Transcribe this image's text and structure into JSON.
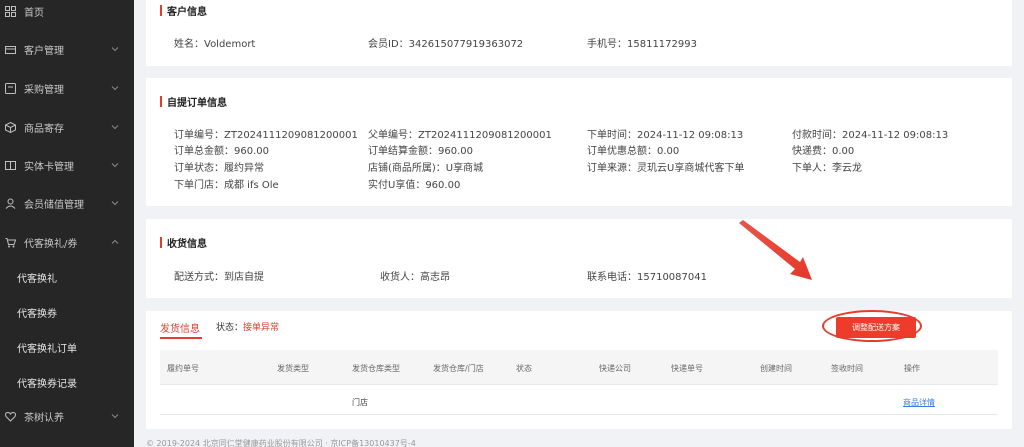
{
  "sidebar": {
    "items": [
      {
        "label": "首页",
        "icon": "grid-icon"
      },
      {
        "label": "客户管理",
        "icon": "folder-icon"
      },
      {
        "label": "采购管理",
        "icon": "cart-icon"
      },
      {
        "label": "商品寄存",
        "icon": "box-icon"
      },
      {
        "label": "实体卡管理",
        "icon": "book-icon"
      },
      {
        "label": "会员储值管理",
        "icon": "user-icon"
      },
      {
        "label": "代客换礼/券",
        "icon": "cart-icon"
      },
      {
        "label": "茶树认养",
        "icon": "heart-icon"
      }
    ],
    "sub_items": [
      {
        "label": "代客换礼"
      },
      {
        "label": "代客换券"
      },
      {
        "label": "代客换礼订单"
      },
      {
        "label": "代客换券记录"
      }
    ]
  },
  "customer": {
    "title": "客户信息",
    "name": "姓名：Voldemort",
    "member_id": "会员ID：342615077919363072",
    "phone": "手机号：15811172993"
  },
  "order": {
    "title": "自提订单信息",
    "order_no": "订单编号：ZT2024111209081200001",
    "parent_no": "父单编号：ZT2024111209081200001",
    "order_time": "下单时间：2024-11-12 09:08:13",
    "pay_time": "付款时间：2024-11-12 09:08:13",
    "total": "订单总金额：960.00",
    "settle": "订单结算金额：960.00",
    "discount": "订单优惠总额：0.00",
    "express_fee": "快递费：0.00",
    "status": "订单状态：履约异常",
    "shop": "店铺(商品所属)：U享商城",
    "source": "订单来源：灵玑云U享商城代客下单",
    "orderer": "下单人：李云龙",
    "store": "下单门店：成都 ifs Ole",
    "paid": "实付U享值：960.00"
  },
  "receive": {
    "title": "收货信息",
    "method": "配送方式：到店自提",
    "receiver": "收货人：高志昂",
    "phone": "联系电话：15710087041"
  },
  "shipping": {
    "tab": "发货信息",
    "status_label": "状态：",
    "status_value": "接单异常",
    "adjust_button": "调整配送方案",
    "columns": [
      "履约单号",
      "发货类型",
      "发货仓库类型",
      "发货仓库/门店",
      "状态",
      "快递公司",
      "快递单号",
      "创建时间",
      "签收时间",
      "操作"
    ],
    "row": {
      "warehouse_type": "门店",
      "action": "商品详情"
    }
  },
  "footer": "© 2019-2024 北京同仁堂健康药业股份有限公司 · 京ICP备13010437号-4",
  "colors": {
    "accent": "#e23d2f",
    "sidebar": "#262626",
    "link": "#3d7ee0"
  }
}
